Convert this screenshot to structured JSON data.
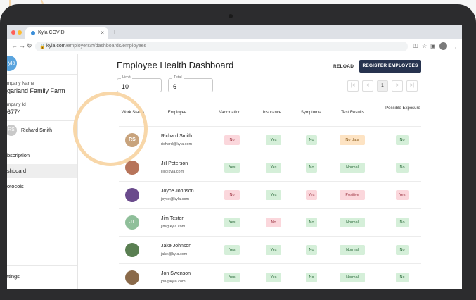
{
  "browser": {
    "tab_title": "Kyla COVID",
    "tab_close": "×",
    "new_tab": "+",
    "url_host": "kyla.com",
    "url_path": "/employers/#/dashboards/employees"
  },
  "sidebar": {
    "logo_text": "yla",
    "company_name_label": "mpany Name",
    "company_name": "garland Family Farm",
    "company_id_label": "mpany Id",
    "company_id": "6774",
    "user_initials": "RS",
    "user_name": "Richard Smith",
    "items": [
      "bscription",
      "shboard",
      "otocols",
      "ttings"
    ]
  },
  "header": {
    "title": "Employee Health Dashboard",
    "reload": "RELOAD",
    "register": "REGISTER EMPLOYEES"
  },
  "filters": {
    "limit_label": "Limit",
    "limit_value": "10",
    "total_label": "Total",
    "total_value": "6"
  },
  "pager": {
    "first": "|<",
    "prev": "<",
    "current": "1",
    "next": ">",
    "last": ">|"
  },
  "columns": [
    "Work Status",
    "Employee",
    "Vaccination",
    "Insurance",
    "Symptoms",
    "Test Results",
    "Possible Exposure"
  ],
  "rows": [
    {
      "avatar": "RS",
      "avatar_color": "#c8a37c",
      "name": "Richard Smith",
      "email": "richard@kyla.com",
      "vaccination": "No",
      "vaccination_status": "red",
      "insurance": "Yes",
      "insurance_status": "green",
      "symptoms": "No",
      "symptoms_status": "green",
      "test": "No data",
      "test_status": "orange",
      "exposure": "No",
      "exposure_status": "green"
    },
    {
      "avatar": "",
      "avatar_color": "#b7745a",
      "name": "Jill Peterson",
      "email": "jill@kyla.com",
      "vaccination": "Yes",
      "vaccination_status": "green",
      "insurance": "Yes",
      "insurance_status": "green",
      "symptoms": "No",
      "symptoms_status": "green",
      "test": "Normal",
      "test_status": "green",
      "exposure": "No",
      "exposure_status": "green"
    },
    {
      "avatar": "",
      "avatar_color": "#6a4b8c",
      "name": "Joyce Johnson",
      "email": "joyce@kyla.com",
      "vaccination": "No",
      "vaccination_status": "red",
      "insurance": "Yes",
      "insurance_status": "green",
      "symptoms": "Yes",
      "symptoms_status": "red",
      "test": "Positive",
      "test_status": "red",
      "exposure": "Yes",
      "exposure_status": "red"
    },
    {
      "avatar": "JT",
      "avatar_color": "#8fbf9a",
      "name": "Jim Tester",
      "email": "jim@kyla.com",
      "vaccination": "Yes",
      "vaccination_status": "green",
      "insurance": "No",
      "insurance_status": "red",
      "symptoms": "No",
      "symptoms_status": "green",
      "test": "Normal",
      "test_status": "green",
      "exposure": "No",
      "exposure_status": "green"
    },
    {
      "avatar": "",
      "avatar_color": "#5a7f52",
      "name": "Jake Johnson",
      "email": "jake@kyla.com",
      "vaccination": "Yes",
      "vaccination_status": "green",
      "insurance": "Yes",
      "insurance_status": "green",
      "symptoms": "No",
      "symptoms_status": "green",
      "test": "Normal",
      "test_status": "green",
      "exposure": "No",
      "exposure_status": "green"
    },
    {
      "avatar": "",
      "avatar_color": "#8a6a4a",
      "name": "Jon Swenson",
      "email": "jon@kyla.com",
      "vaccination": "Yes",
      "vaccination_status": "green",
      "insurance": "Yes",
      "insurance_status": "green",
      "symptoms": "No",
      "symptoms_status": "green",
      "test": "Normal",
      "test_status": "green",
      "exposure": "No",
      "exposure_status": "green"
    }
  ],
  "colors": {
    "accent": "#27334f",
    "highlight": "#f8d7a9",
    "green": "#d5efd9",
    "red": "#fbd7dc",
    "orange": "#fde3c3"
  }
}
